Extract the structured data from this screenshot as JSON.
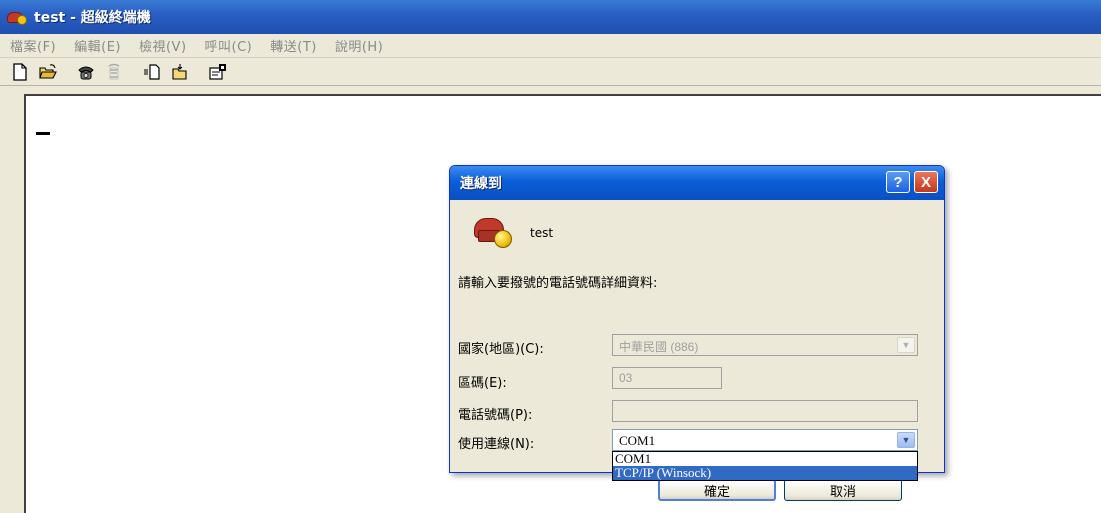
{
  "window": {
    "title": "test - 超級終端機",
    "icon": "hyperterminal-icon"
  },
  "menu": {
    "items": [
      "檔案(F)",
      "編輯(E)",
      "檢視(V)",
      "呼叫(C)",
      "轉送(T)",
      "說明(H)"
    ]
  },
  "toolbar": {
    "buttons": [
      "new-icon",
      "open-icon",
      "call-icon",
      "disconnect-icon",
      "send-icon",
      "receive-icon",
      "properties-icon"
    ]
  },
  "dialog": {
    "title": "連線到",
    "connection_name": "test",
    "instruction": "請輸入要撥號的電話號碼詳細資料:",
    "country_label": "國家(地區)(C):",
    "country_value": "中華民國 (886)",
    "area_label": "區碼(E):",
    "area_value": "03",
    "phone_label": "電話號碼(P):",
    "phone_value": "",
    "connect_label": "使用連線(N):",
    "connect_value": "COM1",
    "connect_options": [
      "COM1",
      "TCP/IP (Winsock)"
    ],
    "selected_option": "TCP/IP (Winsock)",
    "ok_label": "確定",
    "cancel_label": "取消",
    "help_glyph": "?",
    "close_glyph": "X"
  }
}
